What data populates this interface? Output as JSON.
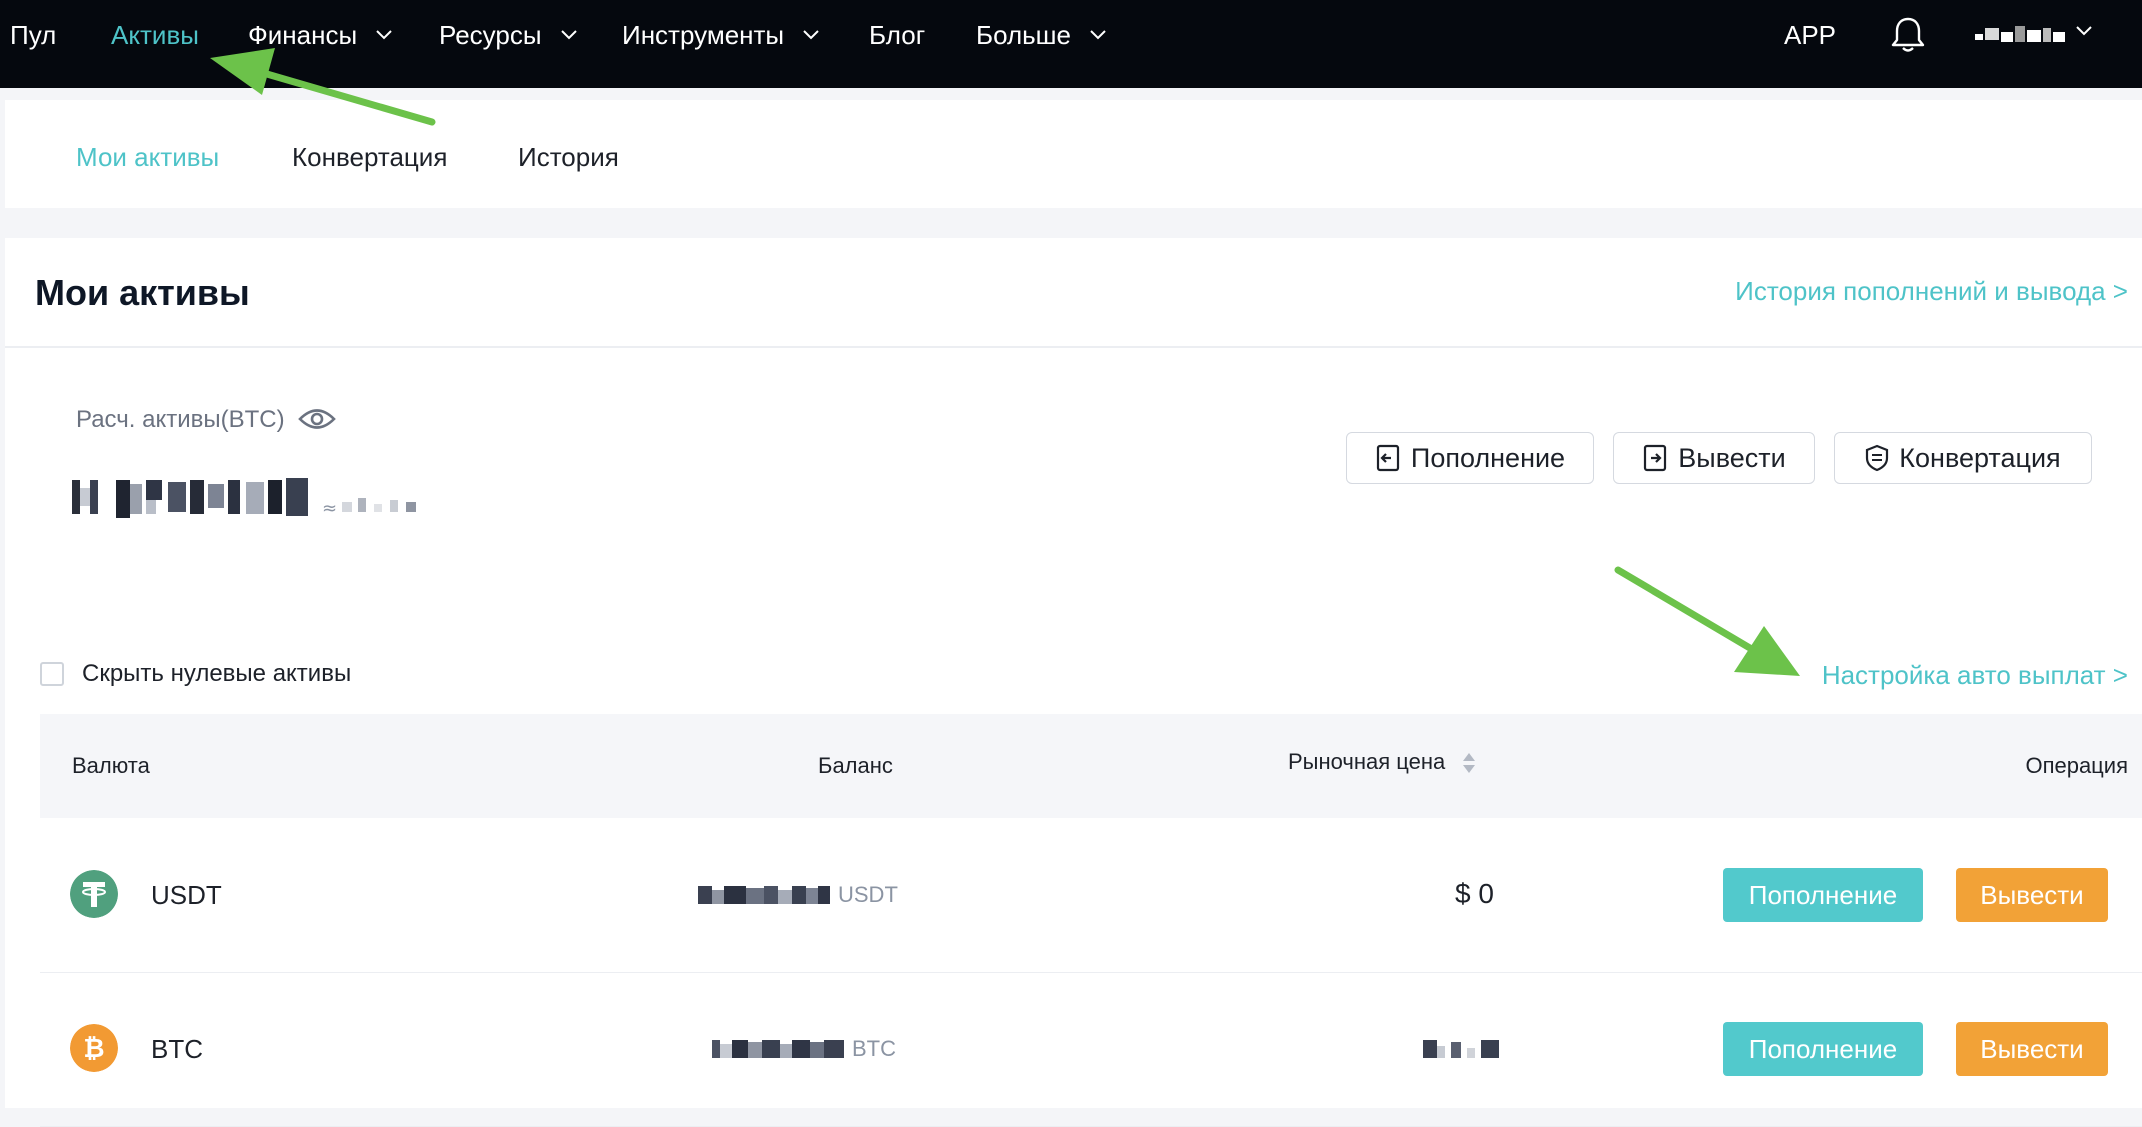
{
  "nav": {
    "items": [
      "Пул",
      "Активы",
      "Финансы",
      "Ресурсы",
      "Инструменты",
      "Блог",
      "Больше"
    ],
    "active_index": 1,
    "app_label": "APP"
  },
  "subtabs": [
    "Мои активы",
    "Конвертация",
    "История"
  ],
  "assets": {
    "title": "Мои активы",
    "history_link": "История пополнений и вывода >",
    "estimate_label": "Расч. активы(BTC)",
    "approx_symbol": "≈",
    "buttons": {
      "deposit": "Пополнение",
      "withdraw": "Вывести",
      "convert": "Конвертация"
    },
    "hide_zero_label": "Скрыть нулевые активы",
    "auto_payout_link": "Настройка авто выплат >"
  },
  "table": {
    "headers": {
      "currency": "Валюта",
      "balance": "Баланс",
      "price": "Рыночная цена",
      "operation": "Операция"
    },
    "rows": [
      {
        "coin": "USDT",
        "unit": "USDT",
        "price": "$ 0",
        "deposit": "Пополнение",
        "withdraw": "Вывести",
        "icon": "tether-icon",
        "color": "#50a07e"
      },
      {
        "coin": "BTC",
        "unit": "BTC",
        "price": "",
        "deposit": "Пополнение",
        "withdraw": "Вывести",
        "icon": "bitcoin-icon",
        "color": "#f29a33"
      }
    ]
  },
  "colors": {
    "accent": "#4ec3c8",
    "deposit_button": "#52c9cc",
    "withdraw_button": "#f2a237",
    "arrow": "#6cc24a"
  }
}
